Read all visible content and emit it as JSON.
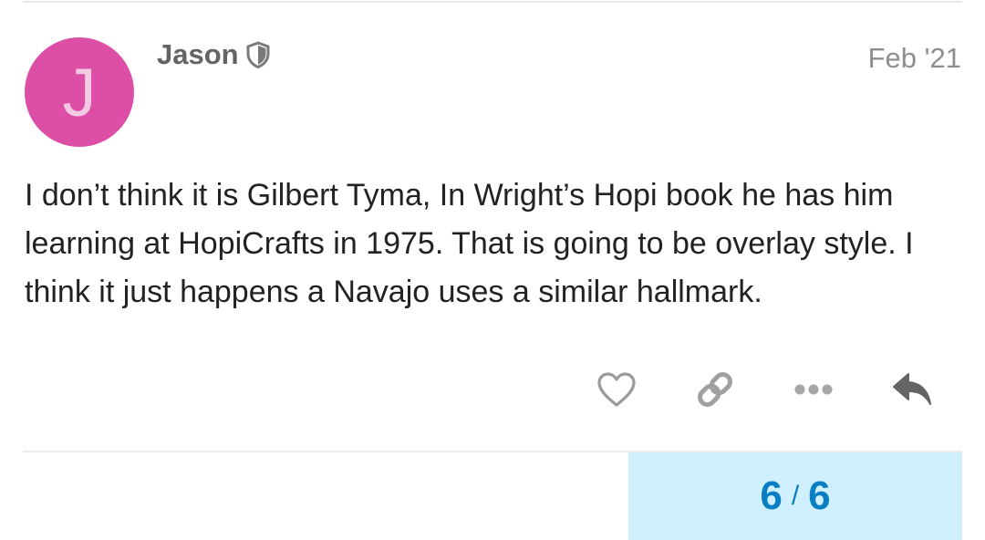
{
  "post": {
    "author": {
      "avatar_letter": "J",
      "avatar_color": "#dd4fa7",
      "name": "Jason",
      "badge_icon": "shield-icon"
    },
    "date": "Feb '21",
    "body": "I don’t think it is Gilbert Tyma, In Wright’s Hopi book he has him learning at HopiCrafts in 1975. That is going to be overlay style. I think it just happens a Navajo uses a similar hallmark."
  },
  "actions": [
    {
      "icon": "heart-icon",
      "label": "like"
    },
    {
      "icon": "link-icon",
      "label": "share"
    },
    {
      "icon": "ellipsis-icon",
      "label": "more"
    },
    {
      "icon": "reply-icon",
      "label": "reply"
    }
  ],
  "progress": {
    "current": "6",
    "separator": "/",
    "total": "6",
    "background_color": "#d1f0ff",
    "text_color": "#0a7ec2"
  }
}
